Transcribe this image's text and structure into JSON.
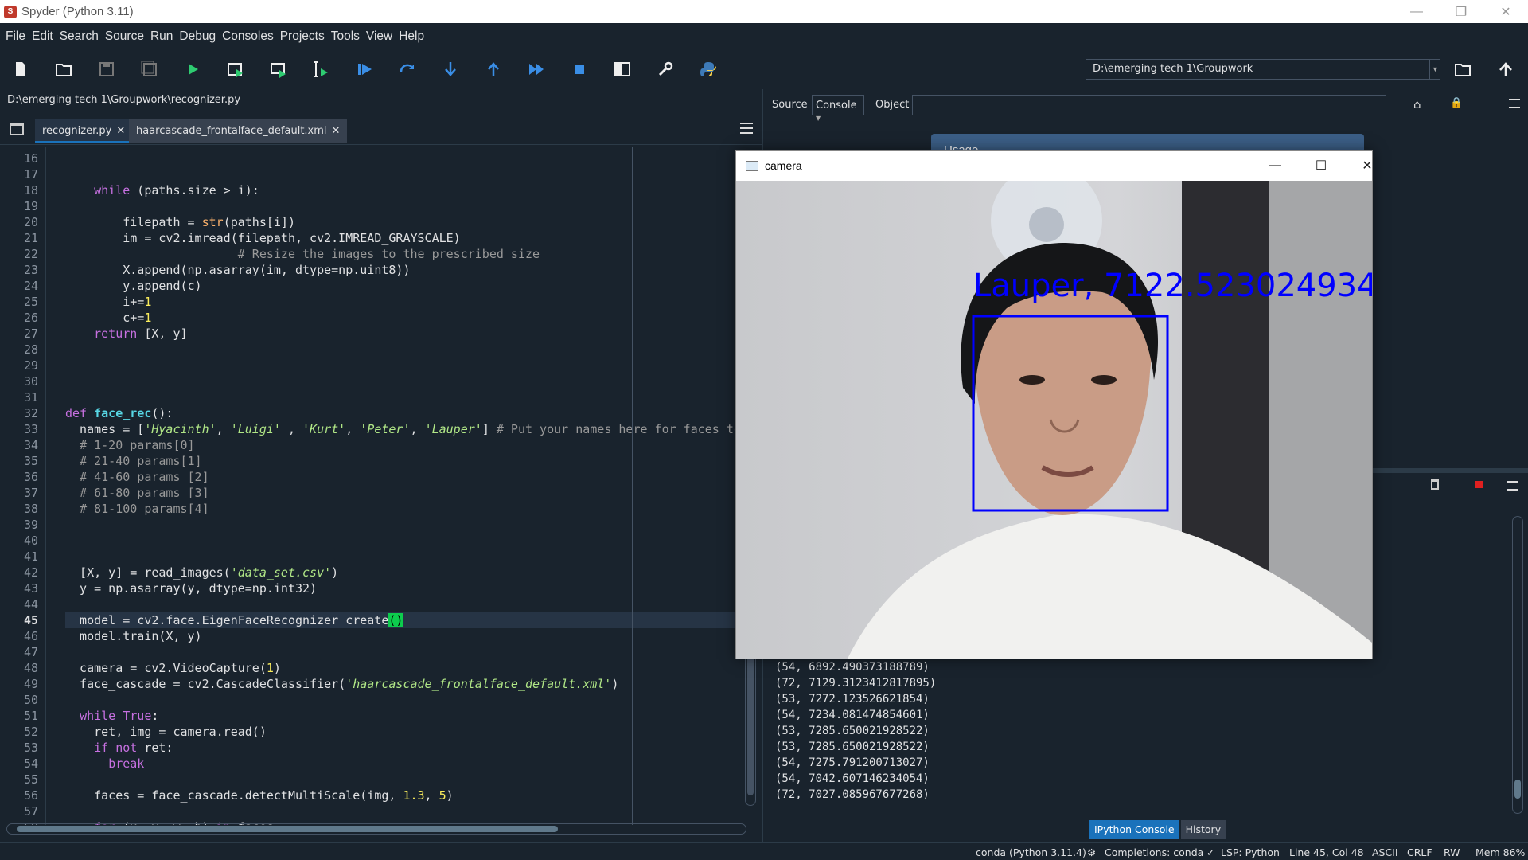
{
  "window": {
    "title": "Spyder (Python 3.11)"
  },
  "menu": [
    "File",
    "Edit",
    "Search",
    "Source",
    "Run",
    "Debug",
    "Consoles",
    "Projects",
    "Tools",
    "View",
    "Help"
  ],
  "toolbar": {
    "icons": [
      "new-file-icon",
      "open-file-icon",
      "save-icon",
      "save-all-icon",
      "run-icon",
      "run-cell-icon",
      "run-cell-advance-icon",
      "run-selection-icon",
      "debug-icon",
      "step-icon",
      "step-into-icon",
      "step-return-icon",
      "continue-icon",
      "stop-icon",
      "maximize-pane-icon",
      "preferences-icon",
      "pythonpath-icon"
    ],
    "cwd": "D:\\emerging tech 1\\Groupwork"
  },
  "editor": {
    "path": "D:\\emerging tech 1\\Groupwork\\recognizer.py",
    "tabs": [
      {
        "label": "recognizer.py",
        "active": true
      },
      {
        "label": "haarcascade_frontalface_default.xml",
        "active": false
      }
    ],
    "current_line": 45,
    "lines": [
      {
        "n": "16",
        "t": ""
      },
      {
        "n": "17",
        "t": ""
      },
      {
        "n": "18",
        "t": "    while (paths.size > i):"
      },
      {
        "n": "19",
        "t": ""
      },
      {
        "n": "20",
        "t": "        filepath = str(paths[i])"
      },
      {
        "n": "21",
        "t": "        im = cv2.imread(filepath, cv2.IMREAD_GRAYSCALE)"
      },
      {
        "n": "22",
        "t": "                        # Resize the images to the prescribed size"
      },
      {
        "n": "23",
        "t": "        X.append(np.asarray(im, dtype=np.uint8))"
      },
      {
        "n": "24",
        "t": "        y.append(c)"
      },
      {
        "n": "25",
        "t": "        i+=1"
      },
      {
        "n": "26",
        "t": "        c+=1"
      },
      {
        "n": "27",
        "t": "    return [X, y]"
      },
      {
        "n": "28",
        "t": ""
      },
      {
        "n": "29",
        "t": ""
      },
      {
        "n": "30",
        "t": ""
      },
      {
        "n": "31",
        "t": ""
      },
      {
        "n": "32",
        "t": "def face_rec():"
      },
      {
        "n": "33",
        "t": "  names = ['Hyacinth', 'Luigi' , 'Kurt', 'Peter', 'Lauper'] # Put your names here for faces to"
      },
      {
        "n": "34",
        "t": "  # 1-20 params[0]"
      },
      {
        "n": "35",
        "t": "  # 21-40 params[1]"
      },
      {
        "n": "36",
        "t": "  # 41-60 params [2]"
      },
      {
        "n": "37",
        "t": "  # 61-80 params [3]"
      },
      {
        "n": "38",
        "t": "  # 81-100 params[4]"
      },
      {
        "n": "39",
        "t": ""
      },
      {
        "n": "40",
        "t": ""
      },
      {
        "n": "41",
        "t": ""
      },
      {
        "n": "42",
        "t": "  [X, y] = read_images('data_set.csv')"
      },
      {
        "n": "43",
        "t": "  y = np.asarray(y, dtype=np.int32)"
      },
      {
        "n": "44",
        "t": ""
      },
      {
        "n": "45",
        "t": "  model = cv2.face.EigenFaceRecognizer_create()"
      },
      {
        "n": "46",
        "t": "  model.train(X, y)"
      },
      {
        "n": "47",
        "t": ""
      },
      {
        "n": "48",
        "t": "  camera = cv2.VideoCapture(1)"
      },
      {
        "n": "49",
        "t": "  face_cascade = cv2.CascadeClassifier('haarcascade_frontalface_default.xml')"
      },
      {
        "n": "50",
        "t": ""
      },
      {
        "n": "51",
        "t": "  while True:"
      },
      {
        "n": "52",
        "t": "    ret, img = camera.read()"
      },
      {
        "n": "53",
        "t": "    if not ret:"
      },
      {
        "n": "54",
        "t": "      break"
      },
      {
        "n": "55",
        "t": ""
      },
      {
        "n": "56",
        "t": "    faces = face_cascade.detectMultiScale(img, 1.3, 5)"
      },
      {
        "n": "57",
        "t": ""
      },
      {
        "n": "58",
        "t": "    for (x, y, w, h) in faces:"
      }
    ]
  },
  "help_pane": {
    "source_label": "Source",
    "source_value": "Console",
    "object_label": "Object",
    "object_value": "",
    "usage_title": "Usage"
  },
  "console": {
    "output": [
      "(54, 6892.490373188789)",
      "(72, 7129.3123412817895)",
      "(53, 7272.123526621854)",
      "(54, 7234.081474854601)",
      "(53, 7285.650021928522)",
      "(53, 7285.650021928522)",
      "(54, 7275.791200713027)",
      "(54, 7042.607146234054)",
      "(72, 7027.085967677268)"
    ],
    "tabs": [
      {
        "label": "IPython Console",
        "active": true
      },
      {
        "label": "History",
        "active": false
      }
    ]
  },
  "camera_window": {
    "title": "camera",
    "overlay_label": "Lauper, 7122.523024934",
    "overlay_color": "#0000ff"
  },
  "statusbar": {
    "env": "conda (Python 3.11.4)",
    "completions": "Completions: conda",
    "lsp": "LSP: Python",
    "position": "Line 45, Col 48",
    "encoding": "ASCII",
    "eol": "CRLF",
    "permissions": "RW",
    "memory": "Mem 86%"
  },
  "colors": {
    "background": "#19232d",
    "accent": "#1a72bb",
    "keyword": "#c670e0",
    "string": "#b0e686",
    "comment": "#999999",
    "number": "#faed5c",
    "function": "#57d6e4"
  }
}
